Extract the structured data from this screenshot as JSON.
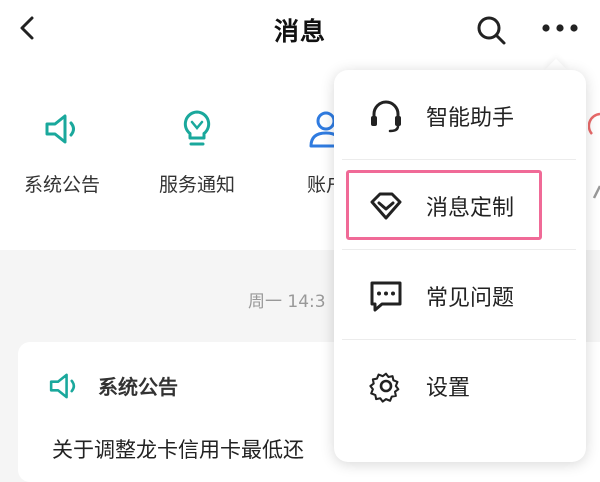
{
  "header": {
    "title": "消息",
    "icons": [
      "back-icon",
      "search-icon",
      "more-icon"
    ]
  },
  "categories": [
    {
      "label": "系统公告",
      "icon": "speaker-icon"
    },
    {
      "label": "服务通知",
      "icon": "lightbulb-icon"
    },
    {
      "label": "账户",
      "icon": "user-icon"
    }
  ],
  "feed": {
    "timestamp": "周一 14:3",
    "card": {
      "title": "系统公告",
      "text": "关于调整龙卡信用卡最低还"
    }
  },
  "menu": {
    "items": [
      {
        "label": "智能助手",
        "icon": "headset-icon"
      },
      {
        "label": "消息定制",
        "icon": "diamond-icon"
      },
      {
        "label": "常见问题",
        "icon": "chat-bubble-icon"
      },
      {
        "label": "设置",
        "icon": "gear-icon"
      }
    ]
  },
  "colors": {
    "accent": "#1aa89c",
    "blue": "#2f7be0",
    "highlight": "#f06a97"
  }
}
